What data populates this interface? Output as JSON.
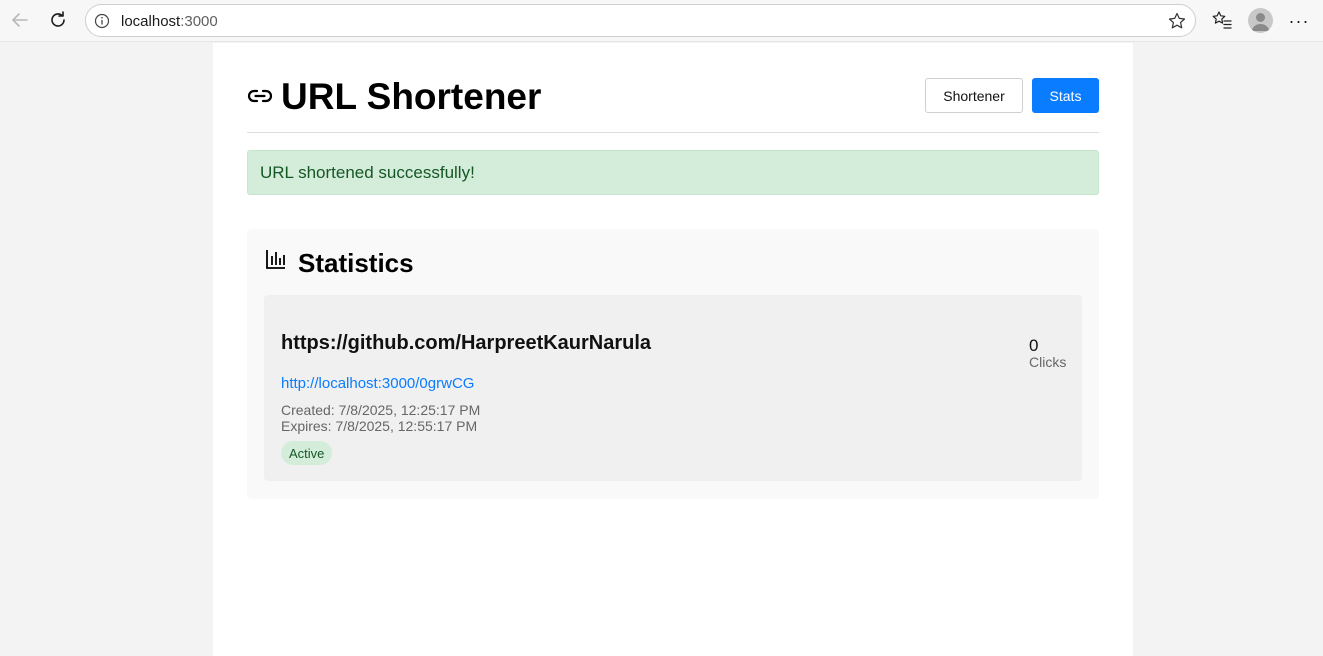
{
  "browser": {
    "url_host": "localhost",
    "url_port": ":3000"
  },
  "header": {
    "title": "URL Shortener",
    "buttons": {
      "shortener": "Shortener",
      "stats": "Stats"
    }
  },
  "alert": {
    "message": "URL shortened successfully!"
  },
  "stats": {
    "title": "Statistics",
    "items": [
      {
        "original_url": "https://github.com/HarpreetKaurNarula",
        "short_url": "http://localhost:3000/0grwCG",
        "created": "Created: 7/8/2025, 12:25:17 PM",
        "expires": "Expires: 7/8/2025, 12:55:17 PM",
        "status": "Active",
        "clicks": "0",
        "clicks_label": "Clicks"
      }
    ]
  },
  "colors": {
    "primary": "#0a7cff",
    "success_bg": "#d4eddb",
    "success_text": "#155724"
  },
  "icons": [
    "back-icon",
    "reload-icon",
    "info-icon",
    "star-icon",
    "favorites-icon",
    "profile-avatar",
    "more-icon",
    "link-icon",
    "bar-chart-icon"
  ]
}
